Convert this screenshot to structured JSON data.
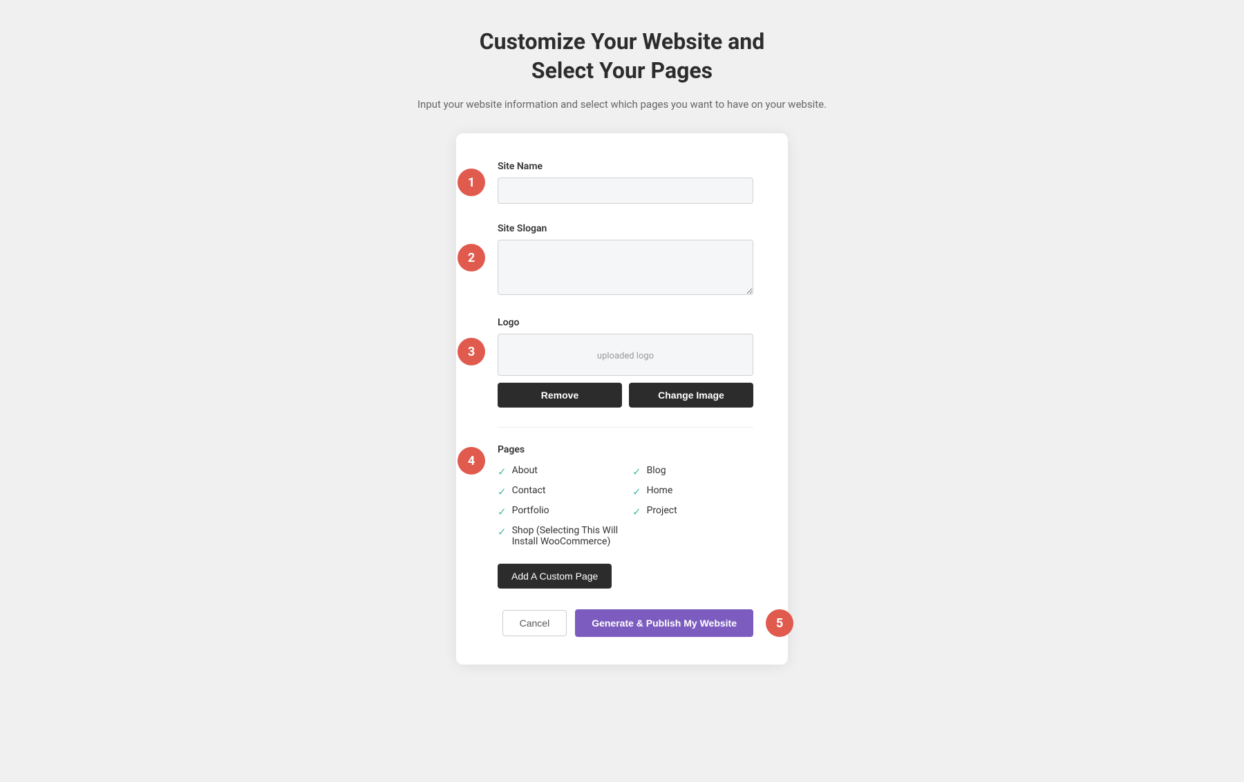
{
  "page": {
    "title_line1": "Customize Your Website and",
    "title_line2": "Select Your Pages",
    "subtitle": "Input your website information and select which pages you want to have on your website."
  },
  "steps": {
    "step1_badge": "1",
    "step2_badge": "2",
    "step3_badge": "3",
    "step4_badge": "4",
    "step5_badge": "5"
  },
  "form": {
    "site_name_label": "Site Name",
    "site_name_placeholder": "",
    "site_slogan_label": "Site Slogan",
    "site_slogan_placeholder": "",
    "logo_label": "Logo",
    "logo_preview_text": "uploaded logo",
    "remove_button": "Remove",
    "change_image_button": "Change Image",
    "pages_label": "Pages",
    "pages": [
      {
        "name": "About",
        "checked": true
      },
      {
        "name": "Blog",
        "checked": true
      },
      {
        "name": "Contact",
        "checked": true
      },
      {
        "name": "Home",
        "checked": true
      },
      {
        "name": "Portfolio",
        "checked": true
      },
      {
        "name": "Project",
        "checked": true
      },
      {
        "name": "Shop (Selecting This Will Install WooCommerce)",
        "checked": true,
        "wide": true
      }
    ],
    "add_custom_page_button": "Add A Custom Page",
    "cancel_button": "Cancel",
    "publish_button": "Generate & Publish My Website"
  }
}
